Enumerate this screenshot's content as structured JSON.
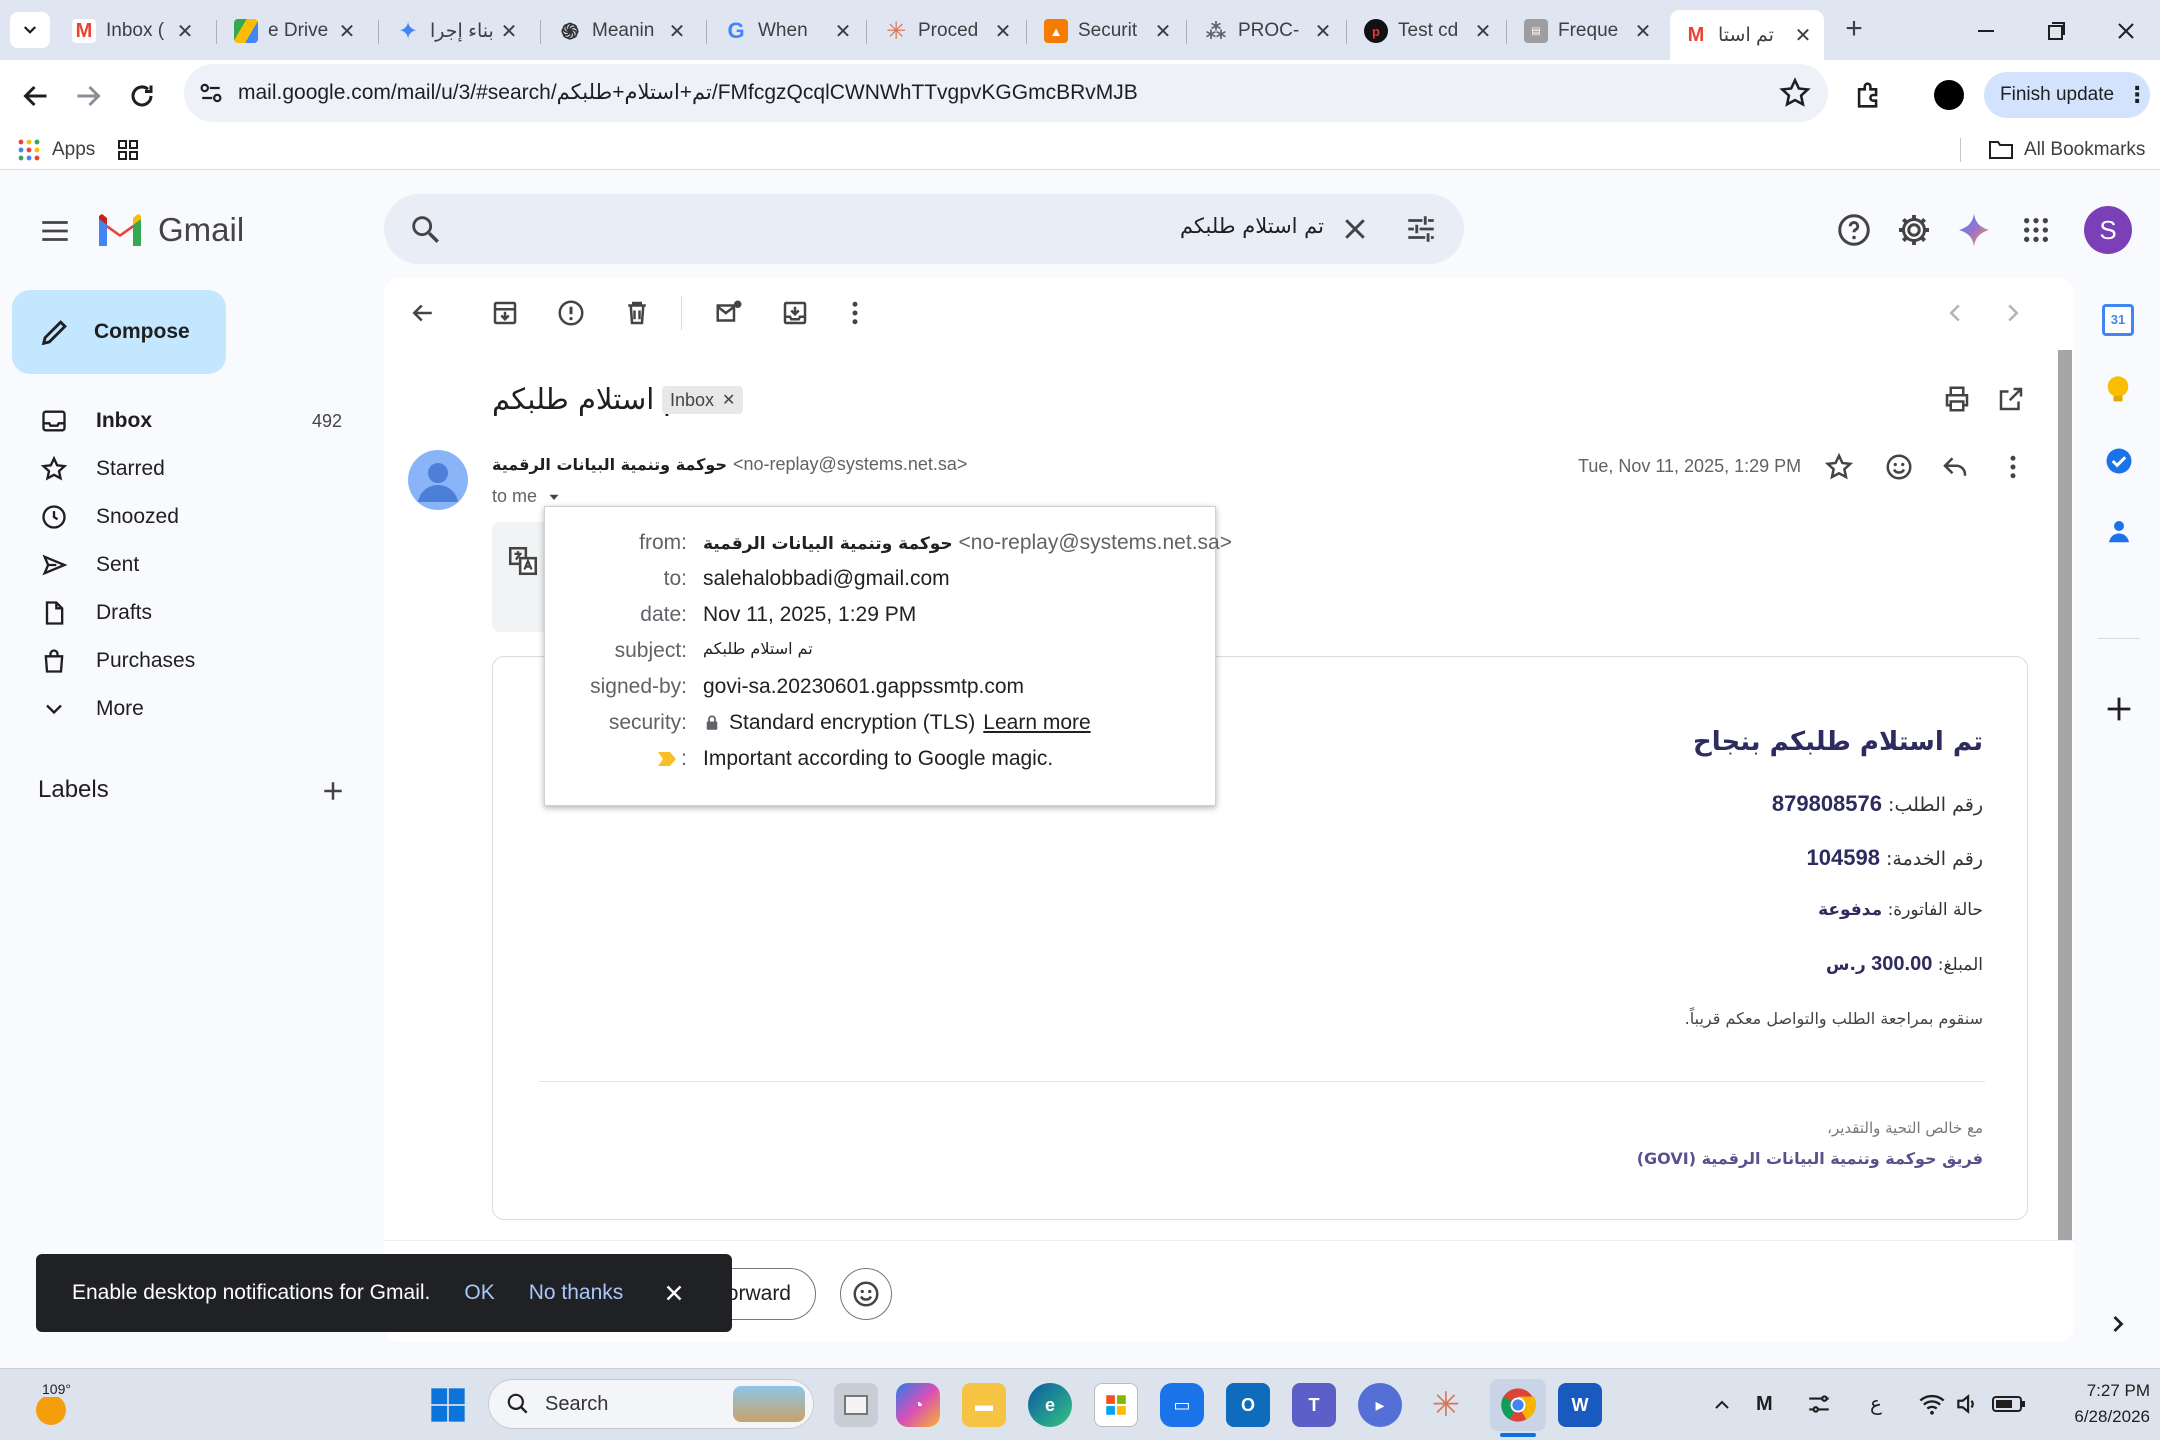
{
  "browser": {
    "tabs": [
      {
        "title": "Inbox (",
        "icon": "gmail-icon"
      },
      {
        "title": "e Drive",
        "icon": "google-drive-icon"
      },
      {
        "title": "بناء إجرا",
        "icon": "gemini-icon"
      },
      {
        "title": "Meanin",
        "icon": "chatgpt-icon"
      },
      {
        "title": "When",
        "icon": "google-icon"
      },
      {
        "title": "Proced",
        "icon": "claude-icon"
      },
      {
        "title": "Securit",
        "icon": "app-icon"
      },
      {
        "title": "PROC-",
        "icon": "app-icon"
      },
      {
        "title": "Test cd",
        "icon": "app-icon"
      },
      {
        "title": "Freque",
        "icon": "app-icon"
      },
      {
        "title": "تم استا",
        "icon": "gmail-icon"
      }
    ],
    "url": "mail.google.com/mail/u/3/#search/تم+استلام+طلبكم/FMfcgzQcqlCWNWhTTvgpvKGGmcBRvMJB",
    "finish_update": "Finish update",
    "bookmarks": {
      "apps": "Apps",
      "all_bookmarks": "All Bookmarks"
    }
  },
  "gmail": {
    "logo_text": "Gmail",
    "search_value": "تم استلام طلبكم",
    "avatar_letter": "S",
    "compose": "Compose",
    "nav": [
      {
        "label": "Inbox",
        "count": "492"
      },
      {
        "label": "Starred",
        "count": ""
      },
      {
        "label": "Snoozed",
        "count": ""
      },
      {
        "label": "Sent",
        "count": ""
      },
      {
        "label": "Drafts",
        "count": ""
      },
      {
        "label": "Purchases",
        "count": ""
      },
      {
        "label": "More",
        "count": ""
      }
    ],
    "labels_heading": "Labels"
  },
  "email": {
    "subject": "تم استلام طلبكم",
    "label_chip": "Inbox",
    "sender_name": "حوكمة وتنمية البيانات الرقمية",
    "sender_email": "<no-replay@systems.net.sa>",
    "to_me": "to me",
    "date": "Tue, Nov 11, 2025, 1:29 PM",
    "details": {
      "from_key": "from:",
      "from_name": "حوكمة وتنمية البيانات الرقمية",
      "from_email": "<no-replay@systems.net.sa>",
      "to_key": "to:",
      "to": "salehalobbadi@gmail.com",
      "date_key": "date:",
      "date": "Nov 11, 2025, 1:29 PM",
      "subject_key": "subject:",
      "subject": "تم استلام طلبكم",
      "signed_key": "signed-by:",
      "signed": "govi-sa.20230601.gappssmtp.com",
      "security_key": "security:",
      "security": "Standard encryption (TLS)",
      "learn_more": "Learn more",
      "importance_key": ":",
      "importance": "Important according to Google magic."
    },
    "body": {
      "heading": "تم استلام طلبكم بنجاح",
      "request_label": "رقم الطلب:",
      "request_value": "879808576",
      "service_label": "رقم الخدمة:",
      "service_value": "104598",
      "invoice_label": "حالة الفاتورة:",
      "invoice_value": "مدفوعة",
      "amount_label": "المبلغ:",
      "amount_value": "300.00",
      "amount_unit": "ر.س",
      "followup": "سنقوم بمراجعة الطلب والتواصل معكم قريباً.",
      "regards": "مع خالص التحية والتقدير،",
      "team": "فريق حوكمة وتنمية البيانات الرقمية (GOVI)"
    },
    "forward": "orward"
  },
  "snackbar": {
    "message": "Enable desktop notifications for Gmail.",
    "ok": "OK",
    "no_thanks": "No thanks"
  },
  "taskbar": {
    "weather": "109°",
    "search": "Search",
    "lang": "ع",
    "time": "7:27 PM",
    "date": "6/28/2026"
  }
}
